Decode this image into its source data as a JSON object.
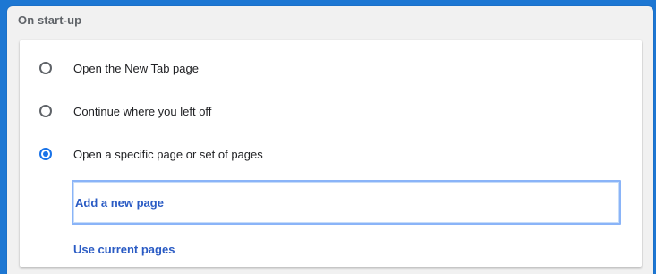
{
  "section": {
    "title": "On start-up"
  },
  "options": [
    {
      "label": "Open the New Tab page",
      "checked": false
    },
    {
      "label": "Continue where you left off",
      "checked": false
    },
    {
      "label": "Open a specific page or set of pages",
      "checked": true
    }
  ],
  "actions": {
    "add_new_page": "Add a new page",
    "use_current_pages": "Use current pages"
  },
  "colors": {
    "background": "#1d77d3",
    "accent": "#1a73e8",
    "link": "#2a5bc4"
  }
}
